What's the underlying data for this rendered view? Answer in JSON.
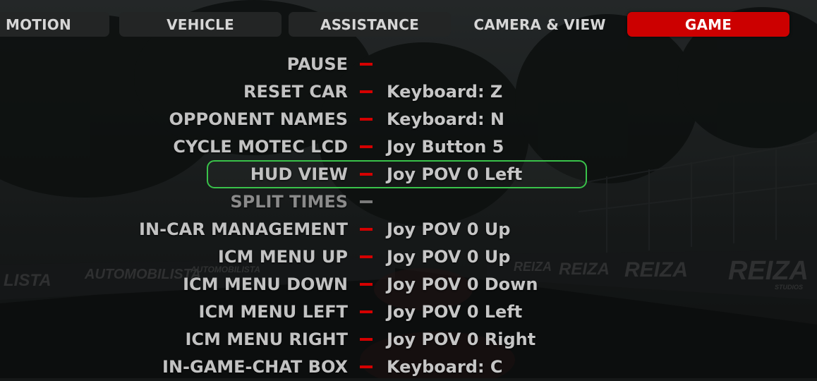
{
  "tabs": [
    {
      "label": "MOTION",
      "active": false
    },
    {
      "label": "VEHICLE",
      "active": false
    },
    {
      "label": "ASSISTANCE",
      "active": false
    },
    {
      "label": "CAMERA & VIEW",
      "active": false
    },
    {
      "label": "GAME",
      "active": true
    }
  ],
  "bindings": [
    {
      "action": "PAUSE",
      "binding": ""
    },
    {
      "action": "RESET CAR",
      "binding": "Keyboard: Z"
    },
    {
      "action": "OPPONENT NAMES",
      "binding": "Keyboard: N"
    },
    {
      "action": "CYCLE MOTEC LCD",
      "binding": "Joy Button 5"
    },
    {
      "action": "HUD VIEW",
      "binding": "Joy POV 0 Left",
      "selected": true
    },
    {
      "action": "SPLIT TIMES",
      "binding": "",
      "disabled": true
    },
    {
      "action": "IN-CAR MANAGEMENT",
      "binding": "Joy POV 0 Up"
    },
    {
      "action": "ICM MENU UP",
      "binding": "Joy POV 0 Up"
    },
    {
      "action": "ICM MENU DOWN",
      "binding": "Joy POV 0 Down"
    },
    {
      "action": "ICM MENU LEFT",
      "binding": "Joy POV 0 Left"
    },
    {
      "action": "ICM MENU RIGHT",
      "binding": "Joy POV 0 Right"
    },
    {
      "action": "IN-GAME-CHAT BOX",
      "binding": "Keyboard: C"
    }
  ],
  "background": {
    "banners": [
      "LISTA",
      "AUTOMOBILISTA",
      "AUTOMOBILISTA",
      "REIZA",
      "REIZA",
      "REIZA",
      "REIZA"
    ],
    "banner_sub": "STUDIOS"
  },
  "colors": {
    "accent": "#cc0000",
    "selection": "#39c24a",
    "text": "#c2c2c2",
    "tab_bg": "#232525"
  }
}
